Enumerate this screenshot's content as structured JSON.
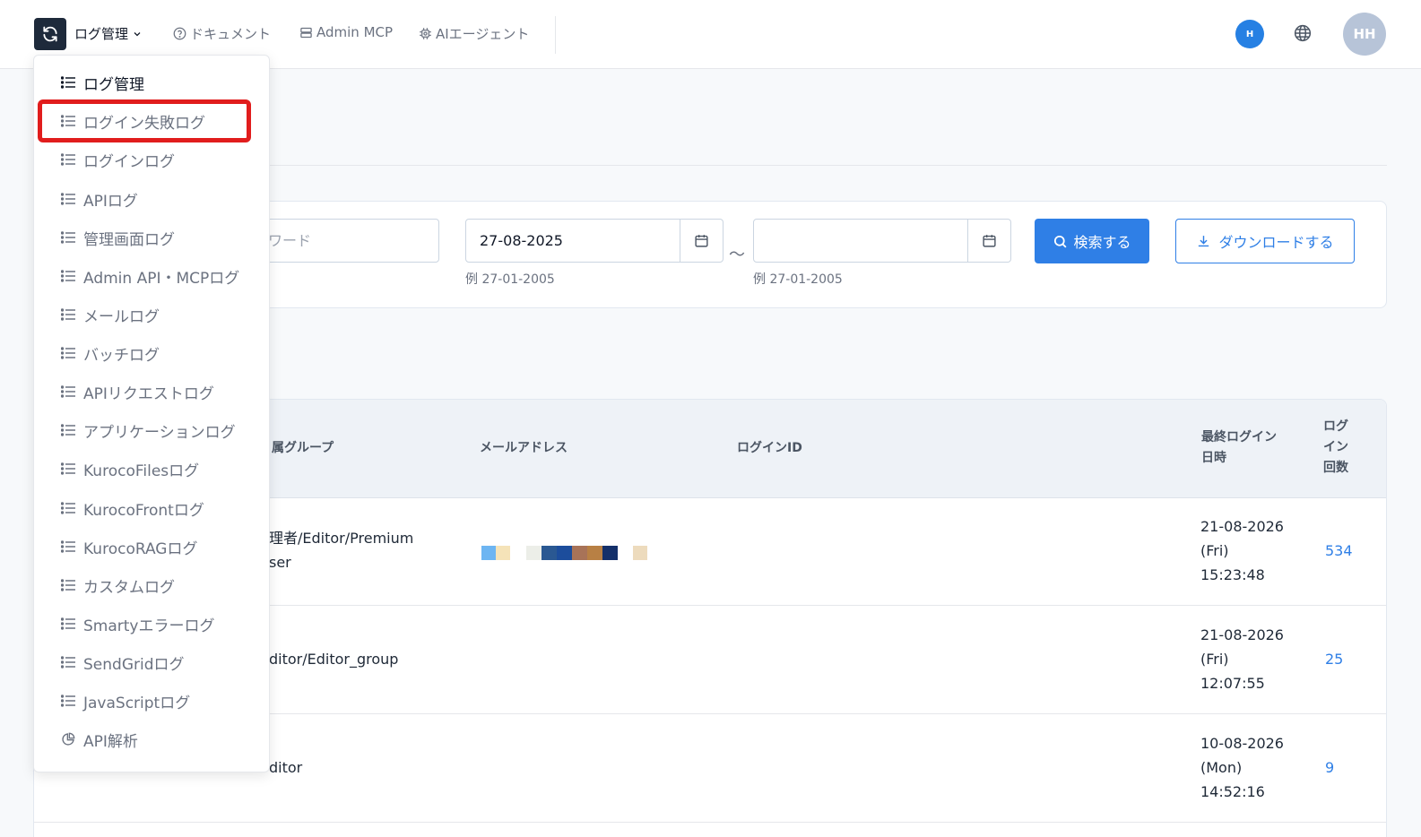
{
  "topbar": {
    "menu_label": "ログ管理",
    "nav": [
      {
        "label": "ドキュメント",
        "icon": "help-circle-icon"
      },
      {
        "label": "Admin MCP",
        "icon": "server-icon"
      },
      {
        "label": "AIエージェント",
        "icon": "chip-icon"
      }
    ],
    "badge": "H",
    "avatar": "HH"
  },
  "filter": {
    "keyword_placeholder_partial": "ワード",
    "date_from": "27-08-2025",
    "date_to": "",
    "separator": "～",
    "hint_from": "例 27-01-2005",
    "hint_to": "例 27-01-2005",
    "search_label": "検索する",
    "download_label": "ダウンロードする"
  },
  "table": {
    "headers": {
      "group_partial": "属グループ",
      "email": "メールアドレス",
      "login_id": "ログインID",
      "last_login": [
        "最終ログイン",
        "日時"
      ],
      "login_count": [
        "ログ",
        "イン",
        "回数"
      ]
    },
    "rows": [
      {
        "group_lines": [
          "理者/Editor/Premium",
          "ser"
        ],
        "last_login": [
          "21-08-2026",
          "(Fri)",
          "15:23:48"
        ],
        "count": "534"
      },
      {
        "group_lines": [
          "ditor/Editor_group"
        ],
        "last_login": [
          "21-08-2026",
          "(Fri)",
          "12:07:55"
        ],
        "count": "25"
      },
      {
        "group_lines": [
          "ditor"
        ],
        "last_login": [
          "10-08-2026",
          "(Mon)",
          "14:52:16"
        ],
        "count": "9"
      }
    ]
  },
  "dropdown": {
    "items": [
      {
        "label": "ログ管理",
        "icon": "list-icon"
      },
      {
        "label": "ログイン失敗ログ",
        "icon": "list-icon"
      },
      {
        "label": "ログインログ",
        "icon": "list-icon"
      },
      {
        "label": "APIログ",
        "icon": "list-icon"
      },
      {
        "label": "管理画面ログ",
        "icon": "list-icon"
      },
      {
        "label": "Admin API・MCPログ",
        "icon": "list-icon"
      },
      {
        "label": "メールログ",
        "icon": "list-icon"
      },
      {
        "label": "バッチログ",
        "icon": "list-icon"
      },
      {
        "label": "APIリクエストログ",
        "icon": "list-icon"
      },
      {
        "label": "アプリケーションログ",
        "icon": "list-icon"
      },
      {
        "label": "KurocoFilesログ",
        "icon": "list-icon"
      },
      {
        "label": "KurocoFrontログ",
        "icon": "list-icon"
      },
      {
        "label": "KurocoRAGログ",
        "icon": "list-icon"
      },
      {
        "label": "カスタムログ",
        "icon": "list-icon"
      },
      {
        "label": "Smartyエラーログ",
        "icon": "list-icon"
      },
      {
        "label": "SendGridログ",
        "icon": "list-icon"
      },
      {
        "label": "JavaScriptログ",
        "icon": "list-icon"
      },
      {
        "label": "API解析",
        "icon": "pie-chart-icon"
      }
    ]
  },
  "colors": {
    "primary": "#2f7fe6",
    "highlight": "#e11d1d",
    "logo_bg": "#1e2a3b"
  }
}
